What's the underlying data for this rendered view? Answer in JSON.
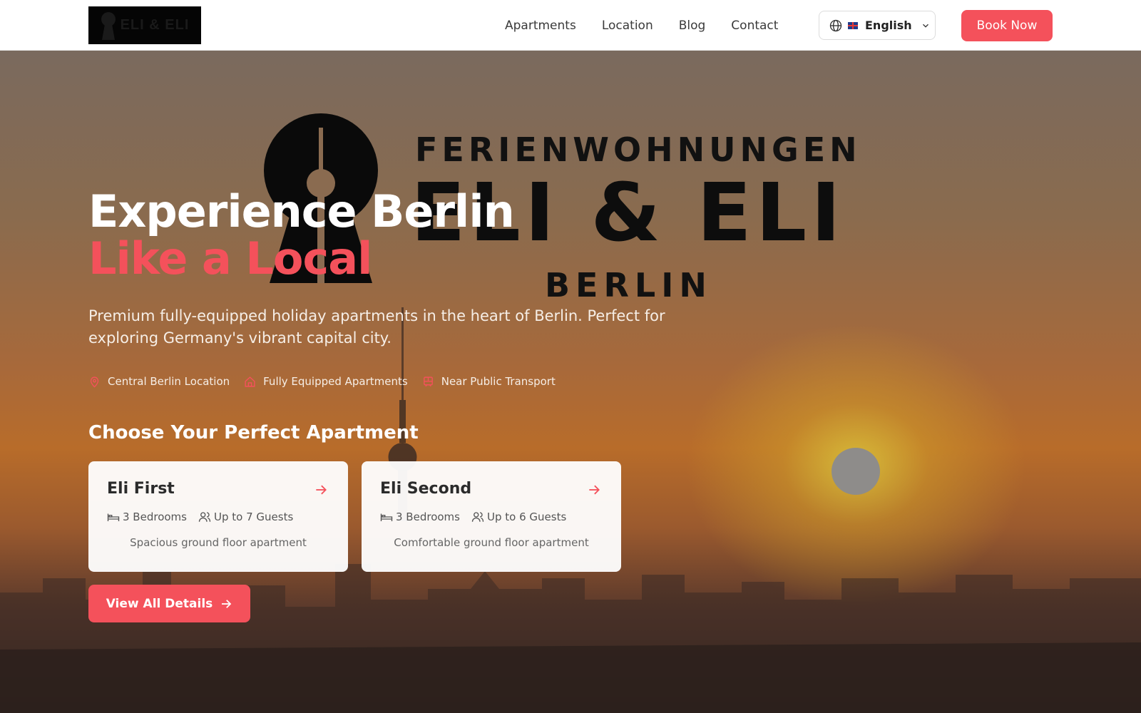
{
  "header": {
    "logo_text": "ELI & ELI",
    "nav": [
      "Apartments",
      "Location",
      "Blog",
      "Contact"
    ],
    "language": "English",
    "book_label": "Book Now"
  },
  "hero": {
    "logo": {
      "line1": "FERIENWOHNUNGEN",
      "line2": "ELI & ELI",
      "line3": "BERLIN"
    },
    "headline_1": "Experience Berlin",
    "headline_2": "Like a Local",
    "subtitle": "Premium fully-equipped holiday apartments in the heart of Berlin. Perfect for exploring Germany's vibrant capital city.",
    "features": [
      {
        "icon": "map-pin-icon",
        "label": "Central Berlin Location"
      },
      {
        "icon": "home-icon",
        "label": "Fully Equipped Apartments"
      },
      {
        "icon": "train-icon",
        "label": "Near Public Transport"
      }
    ],
    "section_title": "Choose Your Perfect Apartment",
    "apartments": [
      {
        "name": "Eli First",
        "bedrooms": "3 Bedrooms",
        "guests": "Up to 7 Guests",
        "description": "Spacious ground floor apartment"
      },
      {
        "name": "Eli Second",
        "bedrooms": "3 Bedrooms",
        "guests": "Up to 6 Guests",
        "description": "Comfortable ground floor apartment"
      }
    ],
    "details_label": "View All Details"
  },
  "colors": {
    "accent": "#f4515b",
    "header_bg": "#ffffff",
    "text_dark": "#2b2b2b"
  }
}
